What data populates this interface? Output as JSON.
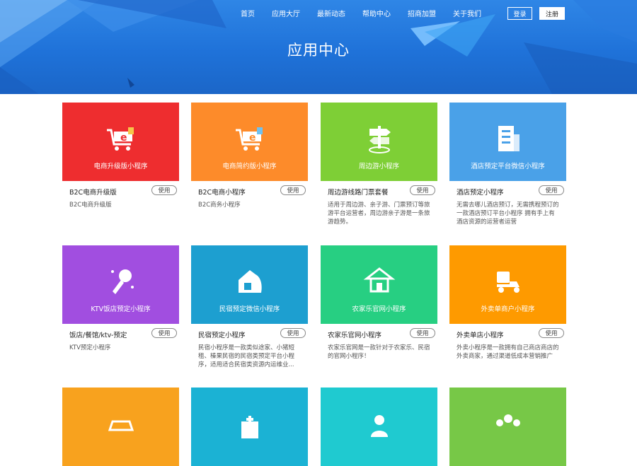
{
  "nav": {
    "items": [
      "首页",
      "应用大厅",
      "最新动态",
      "帮助中心",
      "招商加盟",
      "关于我们"
    ],
    "login": "登录",
    "register": "注册"
  },
  "hero": {
    "title": "应用中心"
  },
  "colors": {
    "red": "#ee2d2f",
    "orange": "#fd8b2a",
    "green": "#7ecf36",
    "blue": "#4aa1e8",
    "purple": "#a14ee0",
    "teal": "#1d9fd0",
    "emerald": "#27cf82",
    "amber": "#fe9a00",
    "yellow": "#f8a21e",
    "cyan": "#1bb2d4",
    "aqua": "#1fcad0",
    "lime": "#77c847"
  },
  "cards": [
    {
      "tile_label": "电商升级版小程序",
      "name": "B2C电商升级版",
      "desc": "B2C电商升级版",
      "use": "使用",
      "icon": "cart-icon"
    },
    {
      "tile_label": "电商简约版小程序",
      "name": "B2C电商小程序",
      "desc": "B2C商务小程序",
      "use": "使用",
      "icon": "cart-icon"
    },
    {
      "tile_label": "周边游小程序",
      "name": "周边游线路门票套餐",
      "desc": "适用于周边游、亲子游、门票预订等旅游平台运营者，周边游亲子游是一条旅游趋势。",
      "use": "使用",
      "icon": "signpost-icon"
    },
    {
      "tile_label": "酒店预定平台微信小程序",
      "name": "酒店预定小程序",
      "desc": "无需去哪儿酒店预订，无需携程预订的一款酒店预订平台小程序 拥有手上有酒店资源的运营者运营",
      "use": "使用",
      "icon": "building-icon"
    },
    {
      "tile_label": "KTV饭店预定小程序",
      "name": "饭店/餐馆/ktv-预定",
      "desc": "KTV预定小程序",
      "use": "使用",
      "icon": "microphone-icon"
    },
    {
      "tile_label": "民宿预定微信小程序",
      "name": "民宿预定小程序",
      "desc": "民宿小程序是一款类似途家、小猪短租、榛果民宿的民宿类预定平台小程序，适用适合民宿类资源内运维业...",
      "use": "使用",
      "icon": "house-icon"
    },
    {
      "tile_label": "农家乐官网小程序",
      "name": "农家乐官网小程序",
      "desc": "农家乐官网是一款针对于农家乐、民宿的官网小程序！",
      "use": "使用",
      "icon": "farmhouse-icon"
    },
    {
      "tile_label": "外卖单商户小程序",
      "name": "外卖单店小程序",
      "desc": "外卖小程序是一款拥有自己商店商店的外卖商家，通过渠道低成本营销推广",
      "use": "使用",
      "icon": "delivery-icon"
    },
    {
      "tile_label": "",
      "name": "",
      "desc": "",
      "use": "",
      "icon": "car-icon"
    },
    {
      "tile_label": "",
      "name": "",
      "desc": "",
      "use": "",
      "icon": "hospital-icon"
    },
    {
      "tile_label": "",
      "name": "",
      "desc": "",
      "use": "",
      "icon": "person-icon"
    },
    {
      "tile_label": "",
      "name": "",
      "desc": "",
      "use": "",
      "icon": "group-icon"
    }
  ]
}
